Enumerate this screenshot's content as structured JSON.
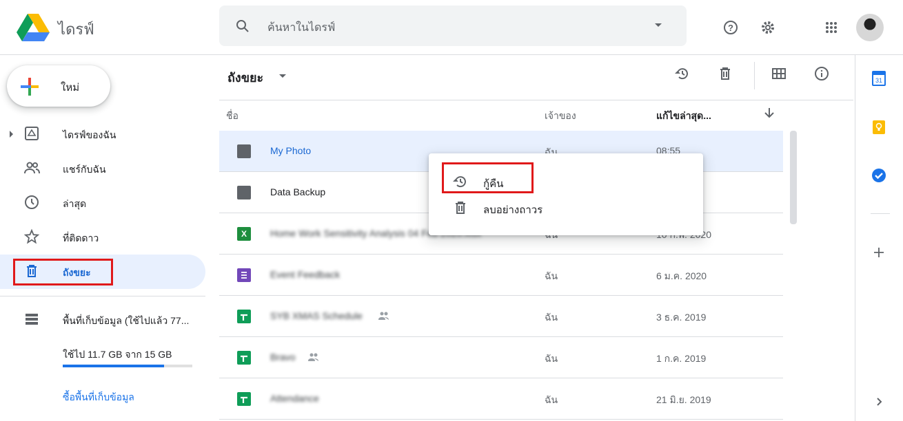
{
  "app": {
    "title": "ไดรฟ์"
  },
  "search": {
    "placeholder": "ค้นหาในไดรฟ์"
  },
  "header_icons": [
    "help-icon",
    "settings-icon",
    "apps-icon"
  ],
  "sidebar": {
    "new_label": "ใหม่",
    "items": [
      {
        "label": "ไดรฟ์ของฉัน",
        "icon": "drive-icon"
      },
      {
        "label": "แชร์กับฉัน",
        "icon": "people-icon"
      },
      {
        "label": "ล่าสุด",
        "icon": "clock-icon"
      },
      {
        "label": "ที่ติดดาว",
        "icon": "star-icon"
      },
      {
        "label": "ถังขยะ",
        "icon": "trash-icon"
      },
      {
        "label": "พื้นที่เก็บข้อมูล (ใช้ไปแล้ว 77...",
        "icon": "storage-icon"
      }
    ],
    "storage_used": "ใช้ไป 11.7 GB จาก 15 GB",
    "storage_fraction": 0.78,
    "buy_storage": "ซื้อพื้นที่เก็บข้อมูล"
  },
  "main": {
    "title": "ถังขยะ",
    "columns": {
      "name": "ชื่อ",
      "owner": "เจ้าของ",
      "modified": "แก้ไขล่าสุด..."
    },
    "files": [
      {
        "name": "My Photo",
        "owner": "ฉัน",
        "date": "08:55",
        "type": "folder"
      },
      {
        "name": "Data Backup",
        "owner": "",
        "date": "",
        "type": "folder"
      },
      {
        "name": "Home Work Sensitivity Analysis 04 Feb 2020.xlsx",
        "owner": "ฉัน",
        "date": "10 ก.พ. 2020",
        "type": "excel"
      },
      {
        "name": "Event Feedback",
        "owner": "ฉัน",
        "date": "6 ม.ค. 2020",
        "type": "form"
      },
      {
        "name": "SYB XMAS Schedule",
        "owner": "ฉัน",
        "date": "3 ธ.ค. 2019",
        "type": "sheet",
        "shared": true
      },
      {
        "name": "Bravo",
        "owner": "ฉัน",
        "date": "1 ก.ค. 2019",
        "type": "sheet",
        "shared": true
      },
      {
        "name": "Attendance",
        "owner": "ฉัน",
        "date": "21 มิ.ย. 2019",
        "type": "sheet"
      }
    ]
  },
  "context_menu": {
    "restore": "กู้คืน",
    "delete_forever": "ลบอย่างถาวร"
  },
  "right_panel": {
    "calendar_day": "31"
  },
  "colors": {
    "accent": "#1a73e8",
    "highlight": "#e0191a",
    "selected_bg": "#e8f0fe"
  }
}
